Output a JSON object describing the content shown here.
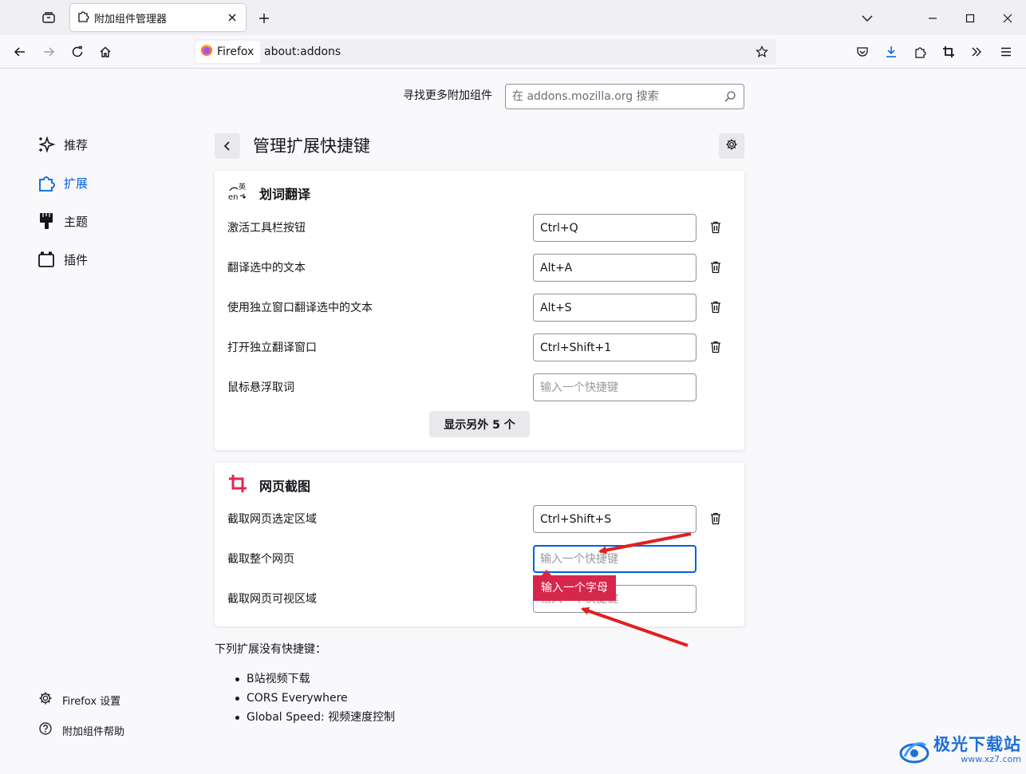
{
  "tab": {
    "title": "附加组件管理器"
  },
  "toolbar": {
    "identity_label": "Firefox",
    "url": "about:addons"
  },
  "header": {
    "find_more_label": "寻找更多附加组件",
    "search_placeholder": "在 addons.mozilla.org 搜索"
  },
  "sidebar": {
    "categories": [
      {
        "label": "推荐",
        "icon": "sparkle-icon"
      },
      {
        "label": "扩展",
        "icon": "puzzle-icon"
      },
      {
        "label": "主题",
        "icon": "brush-icon"
      },
      {
        "label": "插件",
        "icon": "plugin-icon"
      }
    ],
    "footer": [
      {
        "label": "Firefox 设置",
        "icon": "gear-icon"
      },
      {
        "label": "附加组件帮助",
        "icon": "help-icon"
      }
    ]
  },
  "page": {
    "title": "管理扩展快捷键"
  },
  "extensions": [
    {
      "name": "划词翻译",
      "icon": "translate-icon",
      "shortcuts": [
        {
          "label": "激活工具栏按钮",
          "value": "Ctrl+Q"
        },
        {
          "label": "翻译选中的文本",
          "value": "Alt+A"
        },
        {
          "label": "使用独立窗口翻译选中的文本",
          "value": "Alt+S"
        },
        {
          "label": "打开独立翻译窗口",
          "value": "Ctrl+Shift+1"
        },
        {
          "label": "鼠标悬浮取词",
          "value": "",
          "placeholder": "输入一个快捷键"
        }
      ],
      "show_more": "显示另外 5 个"
    },
    {
      "name": "网页截图",
      "icon": "crop-icon",
      "accent": "#e22850",
      "shortcuts": [
        {
          "label": "截取网页选定区域",
          "value": "Ctrl+Shift+S"
        },
        {
          "label": "截取整个网页",
          "value": "",
          "placeholder": "输入一个快捷键"
        },
        {
          "label": "截取网页可视区域",
          "value": "",
          "placeholder": "输入一个快捷键"
        }
      ],
      "error": "输入一个字母"
    }
  ],
  "no_shortcuts": {
    "title": "下列扩展没有快捷键：",
    "items": [
      "B站视频下载",
      "CORS Everywhere",
      "Global Speed: 视频速度控制"
    ]
  },
  "colors": {
    "accent": "#0061e0",
    "error": "#d7264c",
    "annotation_arrow": "#e02020"
  },
  "watermark": {
    "main": "极光下载站",
    "sub": "www.xz7.com"
  }
}
